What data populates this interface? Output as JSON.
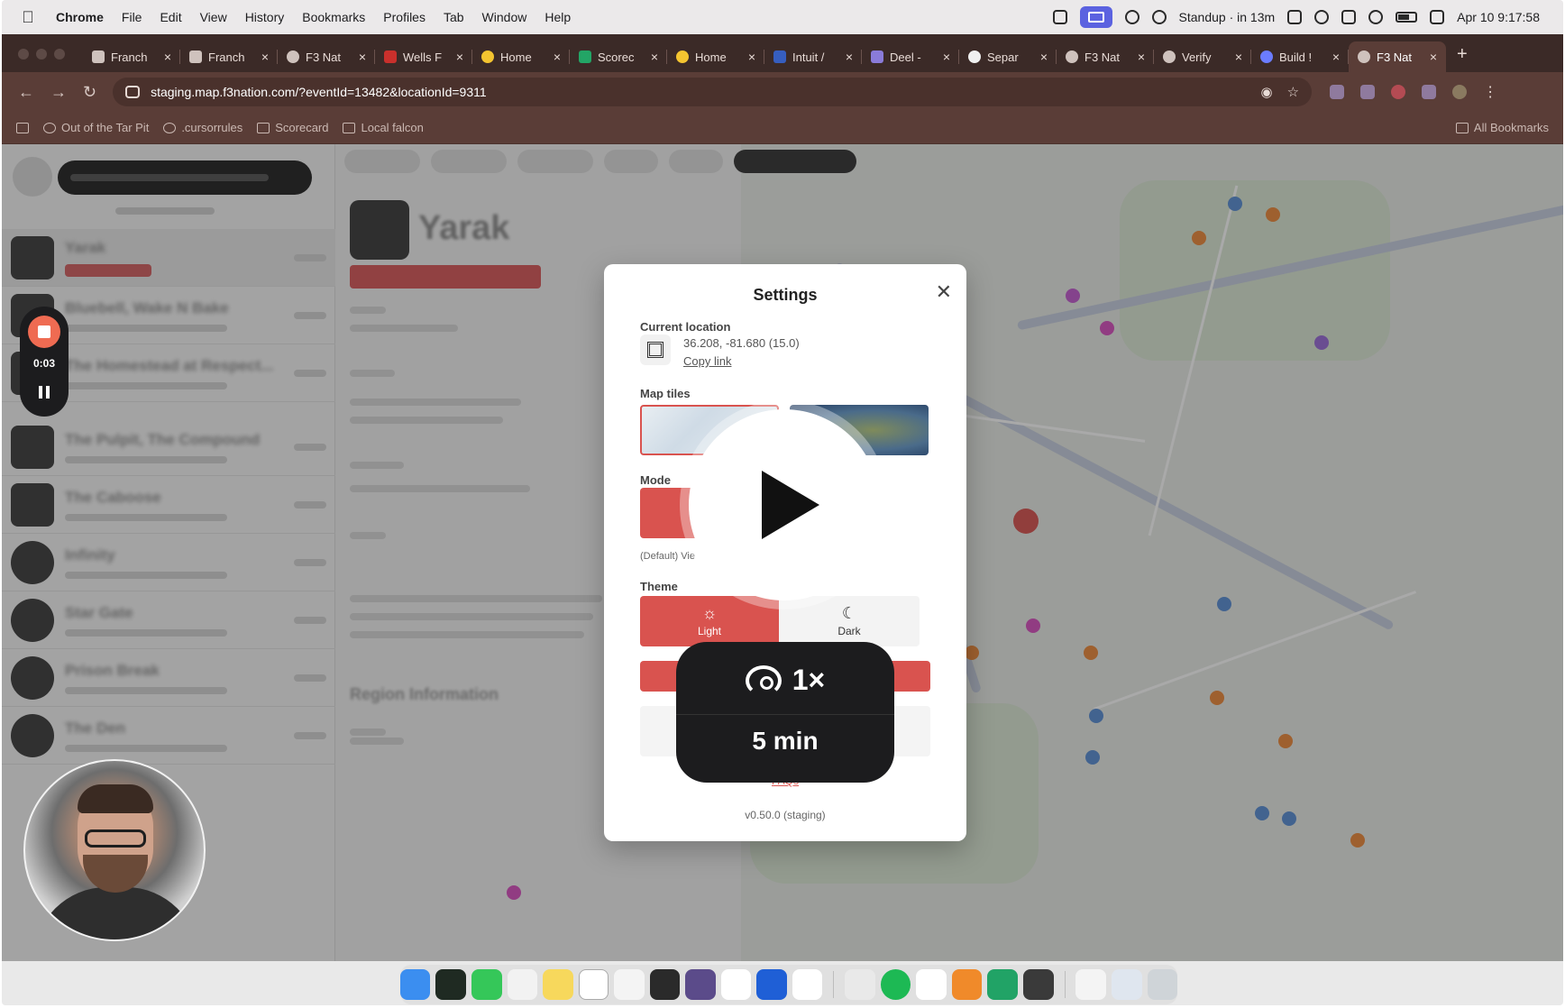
{
  "menubar": {
    "app": "Chrome",
    "items": [
      "File",
      "Edit",
      "View",
      "History",
      "Bookmarks",
      "Profiles",
      "Tab",
      "Window",
      "Help"
    ],
    "standup": "Standup · in 13m",
    "datetime": "Apr 10  9:17:58"
  },
  "tabs": [
    {
      "label": "Franch"
    },
    {
      "label": "Franch"
    },
    {
      "label": "F3 Nat"
    },
    {
      "label": "Wells F"
    },
    {
      "label": "Home"
    },
    {
      "label": "Scorec"
    },
    {
      "label": "Home"
    },
    {
      "label": "Intuit /"
    },
    {
      "label": "Deel -"
    },
    {
      "label": "Separ"
    },
    {
      "label": "F3 Nat"
    },
    {
      "label": "Verify"
    },
    {
      "label": "Build !"
    },
    {
      "label": "F3 Nat"
    }
  ],
  "address": {
    "url": "staging.map.f3nation.com/?eventId=13482&locationId=9311"
  },
  "bookmarks": {
    "items": [
      "Out of the Tar Pit",
      ".cursorrules",
      "Scorecard",
      "Local falcon"
    ],
    "all": "All Bookmarks"
  },
  "sidebar": {
    "locations": [
      {
        "name": "Yarak"
      },
      {
        "name": "Bluebell, Wake N Bake"
      },
      {
        "name": "The Homestead at Respect..."
      },
      {
        "name": "The Pulpit, The Compound"
      },
      {
        "name": "The Caboose"
      },
      {
        "name": "Infinity"
      },
      {
        "name": "Star Gate"
      },
      {
        "name": "Prison Break"
      },
      {
        "name": "The Den"
      }
    ]
  },
  "detail": {
    "title": "Yarak",
    "region_heading": "Region Information"
  },
  "settings": {
    "title": "Settings",
    "current_location_label": "Current location",
    "coords": "36.208, -81.680 (15.0)",
    "copy_link": "Copy link",
    "map_tiles_label": "Map tiles",
    "mode_label": "Mode",
    "mode_note": "(Default) Vie",
    "theme_label": "Theme",
    "light": "Light",
    "dark": "Dark",
    "faqs": "FAQs",
    "version": "v0.50.0 (staging)"
  },
  "player": {
    "speed": "1×",
    "duration": "5 min",
    "rec_time": "0:03"
  },
  "colors": {
    "accent": "#d9534f",
    "tab_bg": "#3b2a27",
    "toolbar_bg": "#5a3d37"
  }
}
